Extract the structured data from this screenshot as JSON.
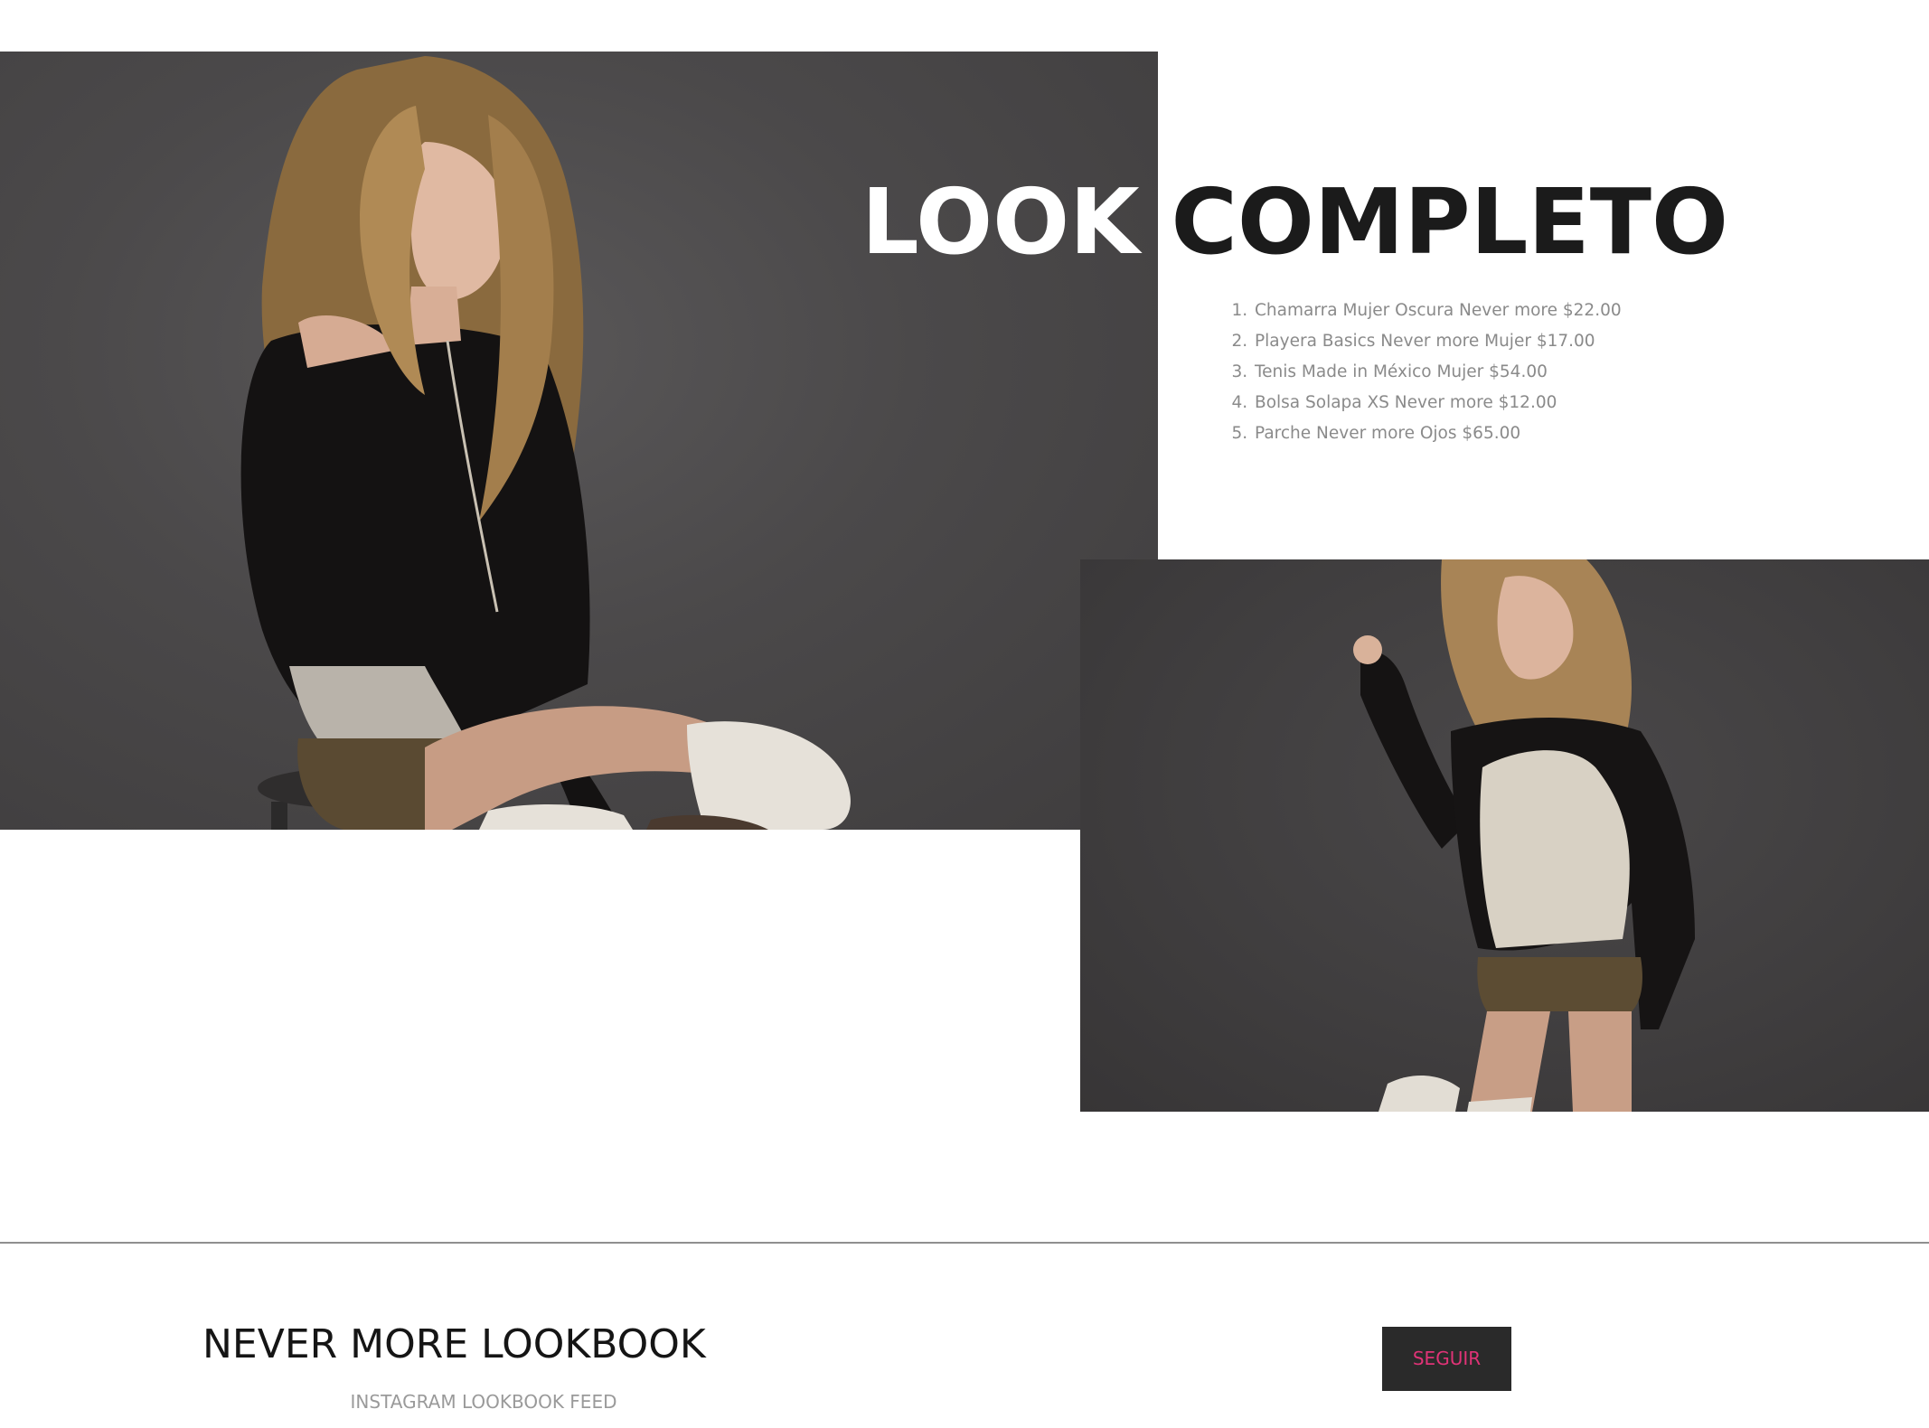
{
  "hero": {
    "title_light": "LOOK",
    "title_dark": "COMPLETO"
  },
  "products": [
    "Chamarra Mujer Oscura Never more $22.00",
    "Playera Basics Never more Mujer $17.00",
    "Tenis Made in México Mujer $54.00",
    "Bolsa Solapa XS Never more $12.00",
    "Parche Never more Ojos $65.00"
  ],
  "lookbook": {
    "title": "NEVER MORE LOOKBOOK",
    "subtitle": "INSTAGRAM LOOKBOOK FEED",
    "follow_label": "SEGUIR"
  },
  "colors": {
    "photo_background": "#4b494a",
    "title_dark": "#1b1b1b",
    "button_background": "#2a2a2a",
    "button_text": "#e03377"
  }
}
